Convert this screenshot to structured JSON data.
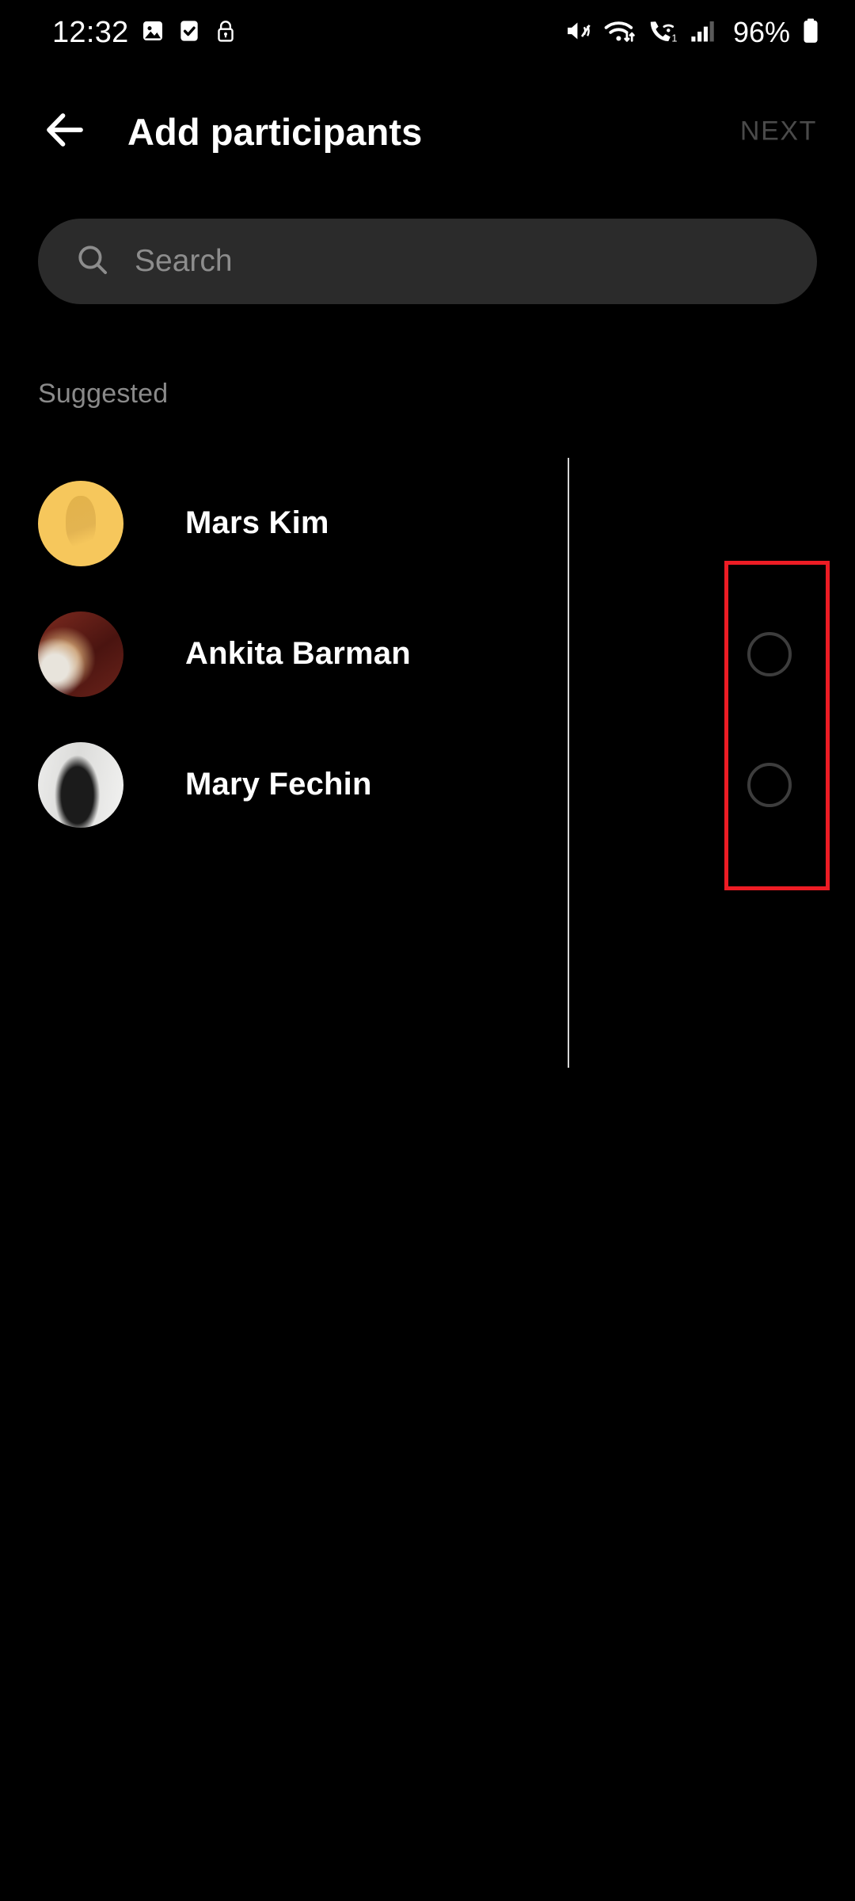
{
  "status_bar": {
    "time": "12:32",
    "battery_percent": "96%",
    "left_icons": [
      "image-icon",
      "checkbox-icon",
      "lock-icon"
    ],
    "right_icons": [
      "mute-vibrate-icon",
      "wifi-icon",
      "call-signal-icon",
      "cellular-signal-icon",
      "battery-icon"
    ]
  },
  "app_bar": {
    "back_icon": "back-arrow-icon",
    "title": "Add participants",
    "next_label": "NEXT",
    "next_enabled": false,
    "next_color": "#4a4a4a"
  },
  "search": {
    "icon": "search-icon",
    "value": "",
    "placeholder": "Search"
  },
  "list": {
    "section_label": "Suggested",
    "contacts": [
      {
        "name": "Mars Kim",
        "avatar": "photo-avatar-yellow",
        "avatar_color": "#f6c75c",
        "selected": false,
        "has_checkbox": false
      },
      {
        "name": "Ankita Barman",
        "avatar": "photo-avatar-maroon",
        "avatar_color": "#6e241c",
        "selected": false,
        "has_checkbox": true
      },
      {
        "name": "Mary Fechin",
        "avatar": "photo-avatar-grayscale",
        "avatar_color": "#d8d8d6",
        "selected": false,
        "has_checkbox": true
      }
    ]
  },
  "annotation": {
    "type": "highlight-rectangle",
    "color": "#ed1c24"
  }
}
